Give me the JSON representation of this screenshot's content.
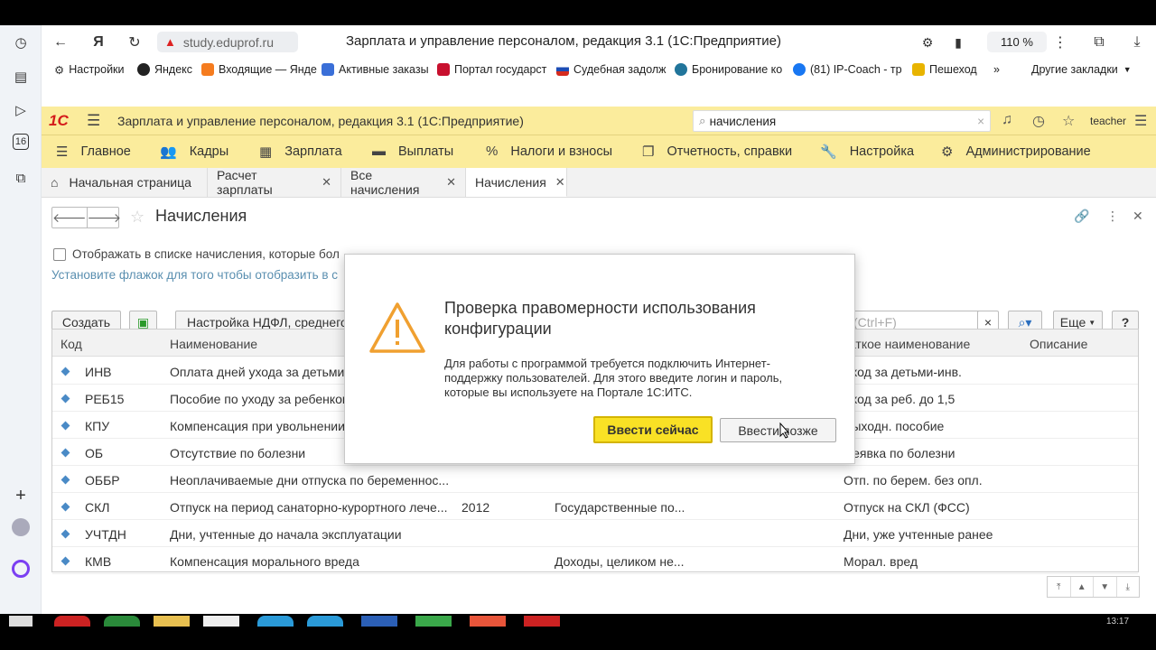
{
  "browser": {
    "url": "study.eduprof.ru",
    "page_title": "Зарплата и управление персоналом, редакция 3.1 (1С:Предприятие)",
    "zoom": "110 %",
    "bookmarks": [
      "Настройки",
      "Яндекс",
      "Входящие — Янде",
      "Активные заказы",
      "Портал государст",
      "Судебная задолж",
      "Бронирование ко",
      "(81) IP-Coach - тр",
      "Пешеход",
      "Другие закладки"
    ]
  },
  "app": {
    "logo": "1С",
    "title": "Зарплата и управление персоналом, редакция 3.1 (1С:Предприятие)",
    "search_value": "начисления",
    "user": "teacher",
    "menu": [
      "Главное",
      "Кадры",
      "Зарплата",
      "Выплаты",
      "Налоги и взносы",
      "Отчетность, справки",
      "Настройка",
      "Администрирование"
    ],
    "tabs": [
      "Начальная страница",
      "Расчет зарплаты",
      "Все начисления",
      "Начисления"
    ]
  },
  "form": {
    "title": "Начисления",
    "checkbox_label": "Отображать в списке начисления, которые бол",
    "hint": "Установите флажок для того чтобы отобразить в с",
    "create_button": "Создать",
    "ndfl_button": "Настройка НДФЛ, среднего",
    "search_placeholder": "(Ctrl+F)",
    "more_button": "Еще",
    "help_button": "?",
    "columns": [
      "Код",
      "Наименование",
      "Краткое наименование",
      "Описание"
    ],
    "rows": [
      {
        "code": "ИНВ",
        "name": "Оплата дней ухода за детьми-",
        "year": "",
        "cat": "",
        "short": "Уход за детьми-инв."
      },
      {
        "code": "РЕБ15",
        "name": "Пособие по уходу за ребенком",
        "year": "",
        "cat": "",
        "short": "Уход за реб. до 1,5"
      },
      {
        "code": "КПУ",
        "name": "Компенсация при увольнении",
        "year": "",
        "cat": "",
        "short": "Выходн. пособие"
      },
      {
        "code": "ОБ",
        "name": "Отсутствие по болезни",
        "year": "",
        "cat": "",
        "short": "Неявка по болезни"
      },
      {
        "code": "ОББР",
        "name": "Неоплачиваемые дни отпуска по беременнос...",
        "year": "",
        "cat": "",
        "short": "Отп. по берем. без опл."
      },
      {
        "code": "СКЛ",
        "name": "Отпуск на период санаторно-курортного лече...",
        "year": "2012",
        "cat": "Государственные по...",
        "short": "Отпуск на СКЛ (ФСС)"
      },
      {
        "code": "УЧТДН",
        "name": "Дни, учтенные до начала эксплуатации",
        "year": "",
        "cat": "",
        "short": "Дни, уже учтенные ранее"
      },
      {
        "code": "КМВ",
        "name": "Компенсация морального вреда",
        "year": "",
        "cat": "Доходы, целиком не...",
        "short": "Морал. вред"
      }
    ]
  },
  "dialog": {
    "title": "Проверка правомерности использования конфигурации",
    "text": "Для работы с программой требуется подключить Интернет-поддержку пользователей. Для этого введите логин и пароль, которые вы используете на Портале 1С:ИТС.",
    "primary_button": "Ввести сейчас",
    "secondary_button": "Ввести позже"
  },
  "taskbar": {
    "clock": "13:17"
  },
  "colors": {
    "accent_yellow": "#fbec9c",
    "button_yellow": "#f9e125",
    "warning_orange": "#f0a030",
    "brand_red": "#d41a1a"
  }
}
